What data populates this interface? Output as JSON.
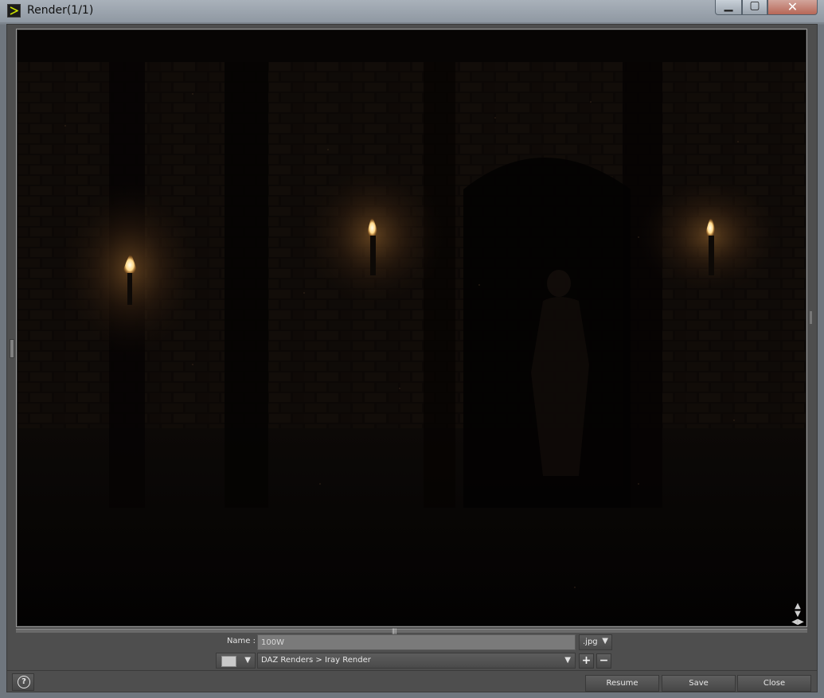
{
  "window": {
    "title": "Render(1/1)",
    "min_glyph": "▁",
    "max_glyph": "▢",
    "close_glyph": "✕",
    "app_icon": "daz-logo-icon"
  },
  "render": {
    "image_description_icons": [
      "torch-flame-icon"
    ]
  },
  "controls": {
    "name_label": "Name :",
    "name_value": "100W",
    "extension": ".jpg",
    "path": "DAZ Renders > Iray Render",
    "plus": "+",
    "minus": "−",
    "arrow": "▼"
  },
  "footer": {
    "help": "?",
    "resume": "Resume",
    "save": "Save",
    "close": "Close"
  },
  "colors": {
    "accent_flame": "#ffd98a",
    "background_dark": "#070504"
  }
}
